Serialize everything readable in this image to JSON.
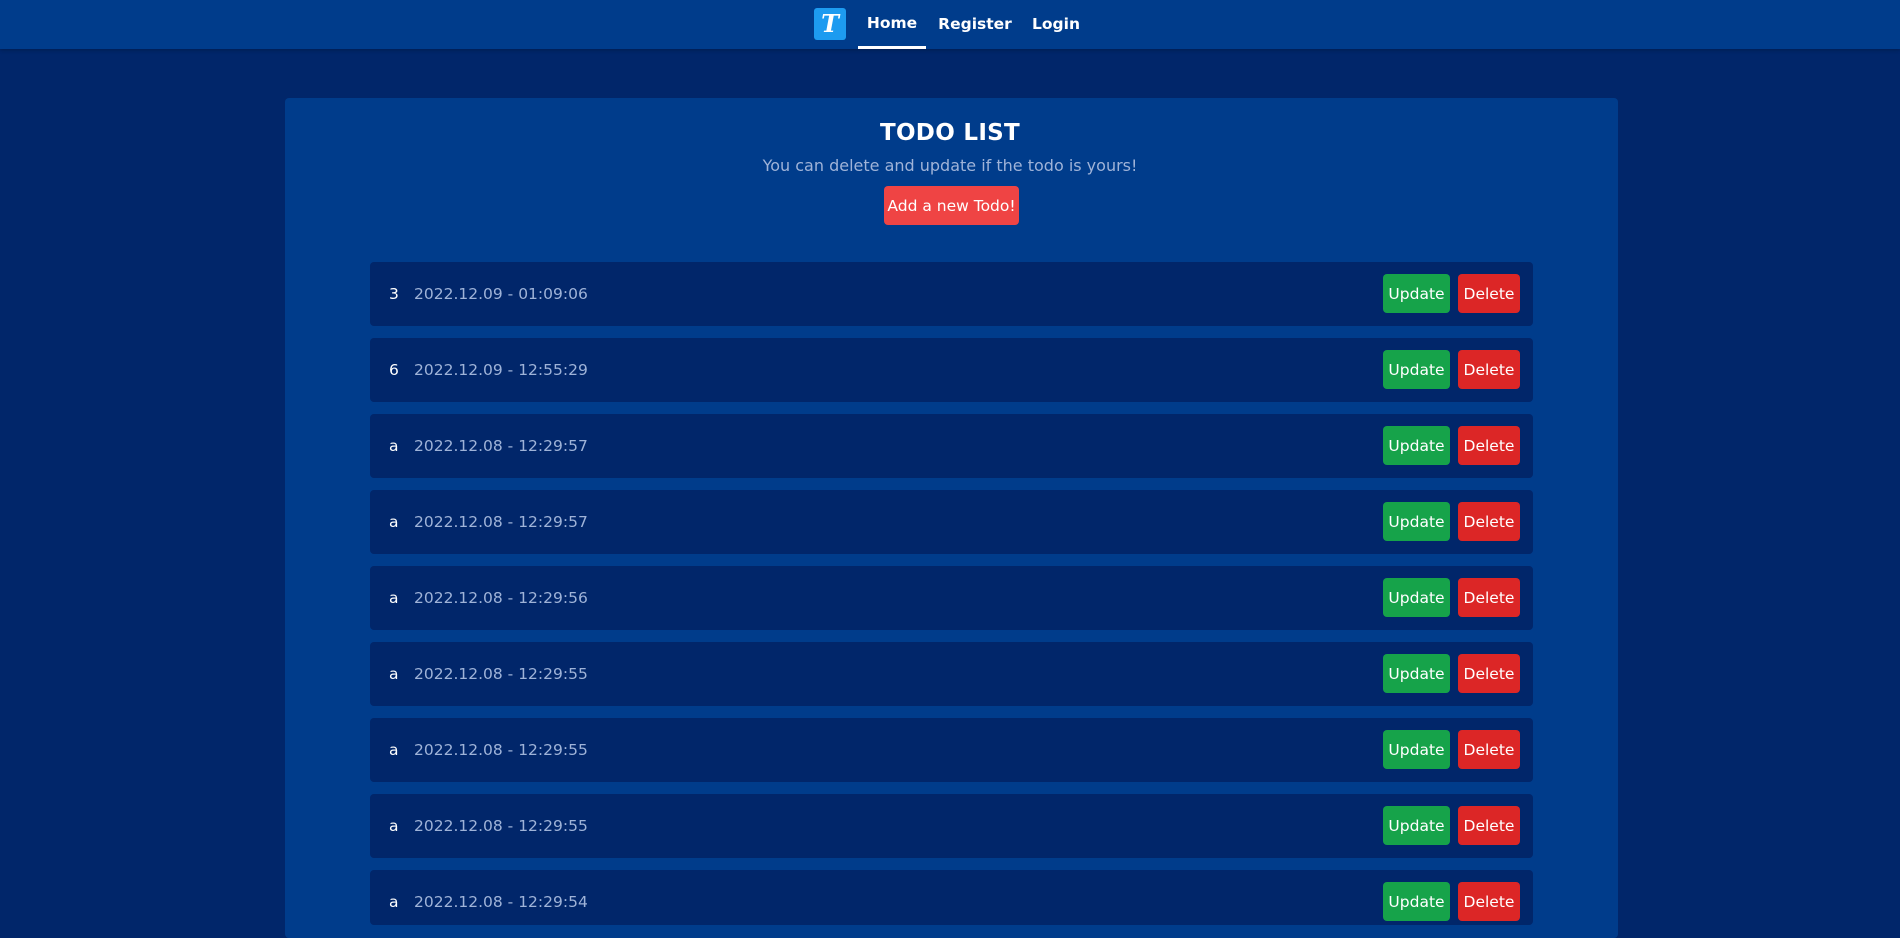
{
  "nav": {
    "logo_letter": "T",
    "items": [
      {
        "label": "Home"
      },
      {
        "label": "Register"
      },
      {
        "label": "Login"
      }
    ]
  },
  "header": {
    "title": "TODO LIST",
    "subtitle": "You can delete and update if the todo is yours!",
    "add_button": "Add a new Todo!"
  },
  "todos": [
    {
      "text": "3",
      "date": "2022.12.09 - 01:09:06"
    },
    {
      "text": "6",
      "date": "2022.12.09 - 12:55:29"
    },
    {
      "text": "a",
      "date": "2022.12.08 - 12:29:57"
    },
    {
      "text": "a",
      "date": "2022.12.08 - 12:29:57"
    },
    {
      "text": "a",
      "date": "2022.12.08 - 12:29:56"
    },
    {
      "text": "a",
      "date": "2022.12.08 - 12:29:55"
    },
    {
      "text": "a",
      "date": "2022.12.08 - 12:29:55"
    },
    {
      "text": "a",
      "date": "2022.12.08 - 12:29:55"
    },
    {
      "text": "a",
      "date": "2022.12.08 - 12:29:54"
    }
  ],
  "actions": {
    "update_label": "Update",
    "delete_label": "Delete"
  },
  "colors": {
    "page_bg": "#01266a",
    "nav_bg": "#003c8b",
    "panel_bg": "#003c8b",
    "row_bg": "#01266a",
    "update": "#16a34a",
    "delete": "#dc2626",
    "add": "#ef4444",
    "logo": "#1d9bf0"
  }
}
